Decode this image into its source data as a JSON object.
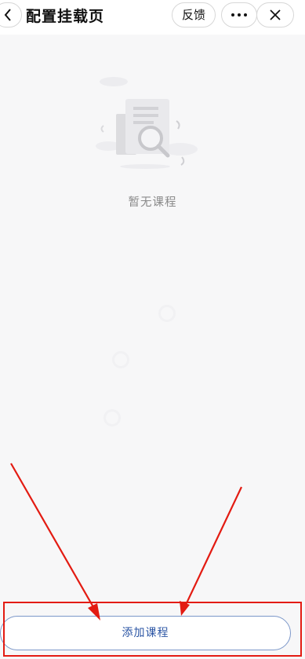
{
  "header": {
    "title": "配置挂载页",
    "feedback_label": "反馈"
  },
  "empty_state": {
    "text": "暂无课程"
  },
  "footer": {
    "add_course_label": "添加课程"
  },
  "colors": {
    "annotation_red": "#e31b12",
    "button_text_blue": "#2b55a4",
    "page_bg": "#f7f7f8"
  },
  "icons": [
    "back-icon",
    "more-icon",
    "close-icon",
    "empty-document-search-icon"
  ]
}
